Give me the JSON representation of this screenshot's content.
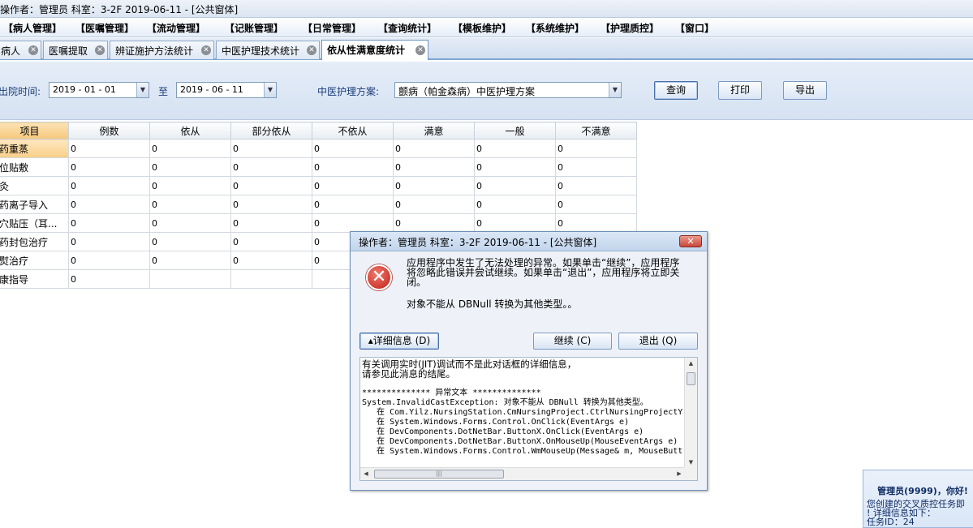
{
  "window": {
    "title": "操作者：管理员  科室：3-2F  2019-06-11 - [公共窗体]"
  },
  "menu": [
    "【病人管理】",
    "【医嘱管理】",
    "【流动管理】",
    "【记账管理】",
    "【日常管理】",
    "【查询统计】",
    "【模板维护】",
    "【系统维护】",
    "【护理质控】",
    "【窗口】"
  ],
  "tabs": [
    {
      "label": "病人",
      "active": false
    },
    {
      "label": "医嘱提取",
      "active": false
    },
    {
      "label": "辨证施护方法统计",
      "active": false
    },
    {
      "label": "中医护理技术统计",
      "active": false
    },
    {
      "label": "依从性满意度统计",
      "active": true
    }
  ],
  "filters": {
    "discharge_label": "出院时间:",
    "start_date": "2019 - 01 - 01",
    "to_label": "至",
    "end_date": "2019 - 06 - 11",
    "plan_label": "中医护理方案:",
    "plan_value": "颤病（帕金森病）中医护理方案",
    "query_label": "查询",
    "print_label": "打印",
    "export_label": "导出"
  },
  "table": {
    "columns": [
      "项目",
      "例数",
      "依从",
      "部分依从",
      "不依从",
      "满意",
      "一般",
      "不满意"
    ],
    "rows": [
      {
        "name": "药重蒸",
        "values": [
          "0",
          "0",
          "0",
          "0",
          "0",
          "0",
          "0"
        ]
      },
      {
        "name": "位贴敷",
        "values": [
          "0",
          "0",
          "0",
          "0",
          "0",
          "0",
          "0"
        ]
      },
      {
        "name": "灸",
        "values": [
          "0",
          "0",
          "0",
          "0",
          "0",
          "0",
          "0"
        ]
      },
      {
        "name": "药离子导入",
        "values": [
          "0",
          "0",
          "0",
          "0",
          "0",
          "0",
          "0"
        ]
      },
      {
        "name": "穴贴压（耳...",
        "values": [
          "0",
          "0",
          "0",
          "0",
          "0",
          "0",
          "0"
        ]
      },
      {
        "name": "药封包治疗",
        "values": [
          "0",
          "0",
          "0",
          "0",
          "",
          "",
          ""
        ]
      },
      {
        "name": "熨治疗",
        "values": [
          "0",
          "0",
          "0",
          "0",
          "",
          "",
          ""
        ]
      },
      {
        "name": "康指导",
        "values": [
          "0",
          "",
          "",
          "",
          "",
          "",
          ""
        ]
      }
    ]
  },
  "dialog": {
    "title": "操作者：管理员  科室：3-2F  2019-06-11 - [公共窗体]",
    "close_glyph": "✕",
    "message": "应用程序中发生了无法处理的异常。如果单击“继续”，应用程序将忽略此错误并尝试继续。如果单击“退出”，应用程序将立即关闭。",
    "message2": "对象不能从 DBNull 转换为其他类型。。",
    "details_button": "▴详细信息 (D)",
    "continue_button": "继续 (C)",
    "exit_button": "退出 (Q)",
    "details_lines": [
      "有关调用实时(JIT)调试而不是此对话框的详细信息，",
      "请参见此消息的结尾。",
      "",
      "************** 异常文本 **************",
      "System.InvalidCastException: 对象不能从 DBNull 转换为其他类型。",
      "   在 Com.Yilz.NursingStation.CmNursingProject.CtrlNursingProjectY",
      "   在 System.Windows.Forms.Control.OnClick(EventArgs e)",
      "   在 DevComponents.DotNetBar.ButtonX.OnClick(EventArgs e)",
      "   在 DevComponents.DotNetBar.ButtonX.OnMouseUp(MouseEventArgs e)",
      "   在 System.Windows.Forms.Control.WmMouseUp(Message& m, MouseButt"
    ]
  },
  "notification": {
    "title": "管理员(9999)，你好!",
    "body": "您创建的交叉质控任务即\n! 详细信息如下：\n任务ID：24"
  },
  "colors": {
    "accent": "#7fa5d3",
    "selected_header": "#f6c87e",
    "error_red": "#c11f15"
  }
}
